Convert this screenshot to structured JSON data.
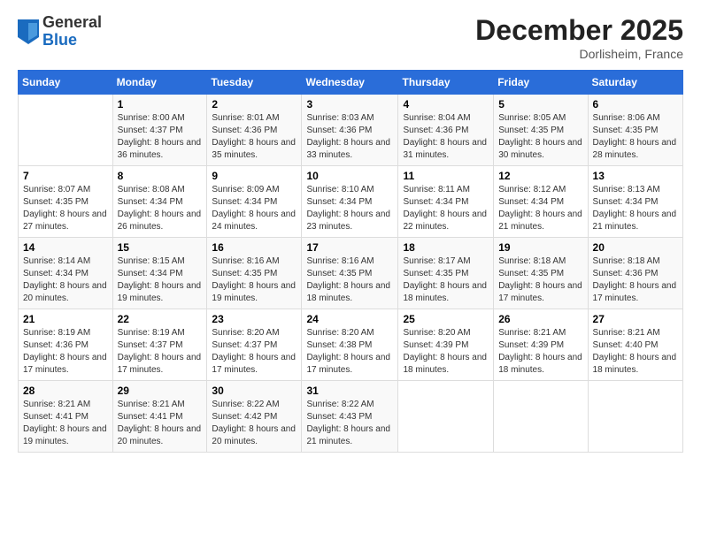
{
  "logo": {
    "general": "General",
    "blue": "Blue"
  },
  "header": {
    "month": "December 2025",
    "location": "Dorlisheim, France"
  },
  "weekdays": [
    "Sunday",
    "Monday",
    "Tuesday",
    "Wednesday",
    "Thursday",
    "Friday",
    "Saturday"
  ],
  "weeks": [
    [
      {
        "day": "",
        "sunrise": "",
        "sunset": "",
        "daylight": ""
      },
      {
        "day": "1",
        "sunrise": "Sunrise: 8:00 AM",
        "sunset": "Sunset: 4:37 PM",
        "daylight": "Daylight: 8 hours and 36 minutes."
      },
      {
        "day": "2",
        "sunrise": "Sunrise: 8:01 AM",
        "sunset": "Sunset: 4:36 PM",
        "daylight": "Daylight: 8 hours and 35 minutes."
      },
      {
        "day": "3",
        "sunrise": "Sunrise: 8:03 AM",
        "sunset": "Sunset: 4:36 PM",
        "daylight": "Daylight: 8 hours and 33 minutes."
      },
      {
        "day": "4",
        "sunrise": "Sunrise: 8:04 AM",
        "sunset": "Sunset: 4:36 PM",
        "daylight": "Daylight: 8 hours and 31 minutes."
      },
      {
        "day": "5",
        "sunrise": "Sunrise: 8:05 AM",
        "sunset": "Sunset: 4:35 PM",
        "daylight": "Daylight: 8 hours and 30 minutes."
      },
      {
        "day": "6",
        "sunrise": "Sunrise: 8:06 AM",
        "sunset": "Sunset: 4:35 PM",
        "daylight": "Daylight: 8 hours and 28 minutes."
      }
    ],
    [
      {
        "day": "7",
        "sunrise": "Sunrise: 8:07 AM",
        "sunset": "Sunset: 4:35 PM",
        "daylight": "Daylight: 8 hours and 27 minutes."
      },
      {
        "day": "8",
        "sunrise": "Sunrise: 8:08 AM",
        "sunset": "Sunset: 4:34 PM",
        "daylight": "Daylight: 8 hours and 26 minutes."
      },
      {
        "day": "9",
        "sunrise": "Sunrise: 8:09 AM",
        "sunset": "Sunset: 4:34 PM",
        "daylight": "Daylight: 8 hours and 24 minutes."
      },
      {
        "day": "10",
        "sunrise": "Sunrise: 8:10 AM",
        "sunset": "Sunset: 4:34 PM",
        "daylight": "Daylight: 8 hours and 23 minutes."
      },
      {
        "day": "11",
        "sunrise": "Sunrise: 8:11 AM",
        "sunset": "Sunset: 4:34 PM",
        "daylight": "Daylight: 8 hours and 22 minutes."
      },
      {
        "day": "12",
        "sunrise": "Sunrise: 8:12 AM",
        "sunset": "Sunset: 4:34 PM",
        "daylight": "Daylight: 8 hours and 21 minutes."
      },
      {
        "day": "13",
        "sunrise": "Sunrise: 8:13 AM",
        "sunset": "Sunset: 4:34 PM",
        "daylight": "Daylight: 8 hours and 21 minutes."
      }
    ],
    [
      {
        "day": "14",
        "sunrise": "Sunrise: 8:14 AM",
        "sunset": "Sunset: 4:34 PM",
        "daylight": "Daylight: 8 hours and 20 minutes."
      },
      {
        "day": "15",
        "sunrise": "Sunrise: 8:15 AM",
        "sunset": "Sunset: 4:34 PM",
        "daylight": "Daylight: 8 hours and 19 minutes."
      },
      {
        "day": "16",
        "sunrise": "Sunrise: 8:16 AM",
        "sunset": "Sunset: 4:35 PM",
        "daylight": "Daylight: 8 hours and 19 minutes."
      },
      {
        "day": "17",
        "sunrise": "Sunrise: 8:16 AM",
        "sunset": "Sunset: 4:35 PM",
        "daylight": "Daylight: 8 hours and 18 minutes."
      },
      {
        "day": "18",
        "sunrise": "Sunrise: 8:17 AM",
        "sunset": "Sunset: 4:35 PM",
        "daylight": "Daylight: 8 hours and 18 minutes."
      },
      {
        "day": "19",
        "sunrise": "Sunrise: 8:18 AM",
        "sunset": "Sunset: 4:35 PM",
        "daylight": "Daylight: 8 hours and 17 minutes."
      },
      {
        "day": "20",
        "sunrise": "Sunrise: 8:18 AM",
        "sunset": "Sunset: 4:36 PM",
        "daylight": "Daylight: 8 hours and 17 minutes."
      }
    ],
    [
      {
        "day": "21",
        "sunrise": "Sunrise: 8:19 AM",
        "sunset": "Sunset: 4:36 PM",
        "daylight": "Daylight: 8 hours and 17 minutes."
      },
      {
        "day": "22",
        "sunrise": "Sunrise: 8:19 AM",
        "sunset": "Sunset: 4:37 PM",
        "daylight": "Daylight: 8 hours and 17 minutes."
      },
      {
        "day": "23",
        "sunrise": "Sunrise: 8:20 AM",
        "sunset": "Sunset: 4:37 PM",
        "daylight": "Daylight: 8 hours and 17 minutes."
      },
      {
        "day": "24",
        "sunrise": "Sunrise: 8:20 AM",
        "sunset": "Sunset: 4:38 PM",
        "daylight": "Daylight: 8 hours and 17 minutes."
      },
      {
        "day": "25",
        "sunrise": "Sunrise: 8:20 AM",
        "sunset": "Sunset: 4:39 PM",
        "daylight": "Daylight: 8 hours and 18 minutes."
      },
      {
        "day": "26",
        "sunrise": "Sunrise: 8:21 AM",
        "sunset": "Sunset: 4:39 PM",
        "daylight": "Daylight: 8 hours and 18 minutes."
      },
      {
        "day": "27",
        "sunrise": "Sunrise: 8:21 AM",
        "sunset": "Sunset: 4:40 PM",
        "daylight": "Daylight: 8 hours and 18 minutes."
      }
    ],
    [
      {
        "day": "28",
        "sunrise": "Sunrise: 8:21 AM",
        "sunset": "Sunset: 4:41 PM",
        "daylight": "Daylight: 8 hours and 19 minutes."
      },
      {
        "day": "29",
        "sunrise": "Sunrise: 8:21 AM",
        "sunset": "Sunset: 4:41 PM",
        "daylight": "Daylight: 8 hours and 20 minutes."
      },
      {
        "day": "30",
        "sunrise": "Sunrise: 8:22 AM",
        "sunset": "Sunset: 4:42 PM",
        "daylight": "Daylight: 8 hours and 20 minutes."
      },
      {
        "day": "31",
        "sunrise": "Sunrise: 8:22 AM",
        "sunset": "Sunset: 4:43 PM",
        "daylight": "Daylight: 8 hours and 21 minutes."
      },
      {
        "day": "",
        "sunrise": "",
        "sunset": "",
        "daylight": ""
      },
      {
        "day": "",
        "sunrise": "",
        "sunset": "",
        "daylight": ""
      },
      {
        "day": "",
        "sunrise": "",
        "sunset": "",
        "daylight": ""
      }
    ]
  ]
}
